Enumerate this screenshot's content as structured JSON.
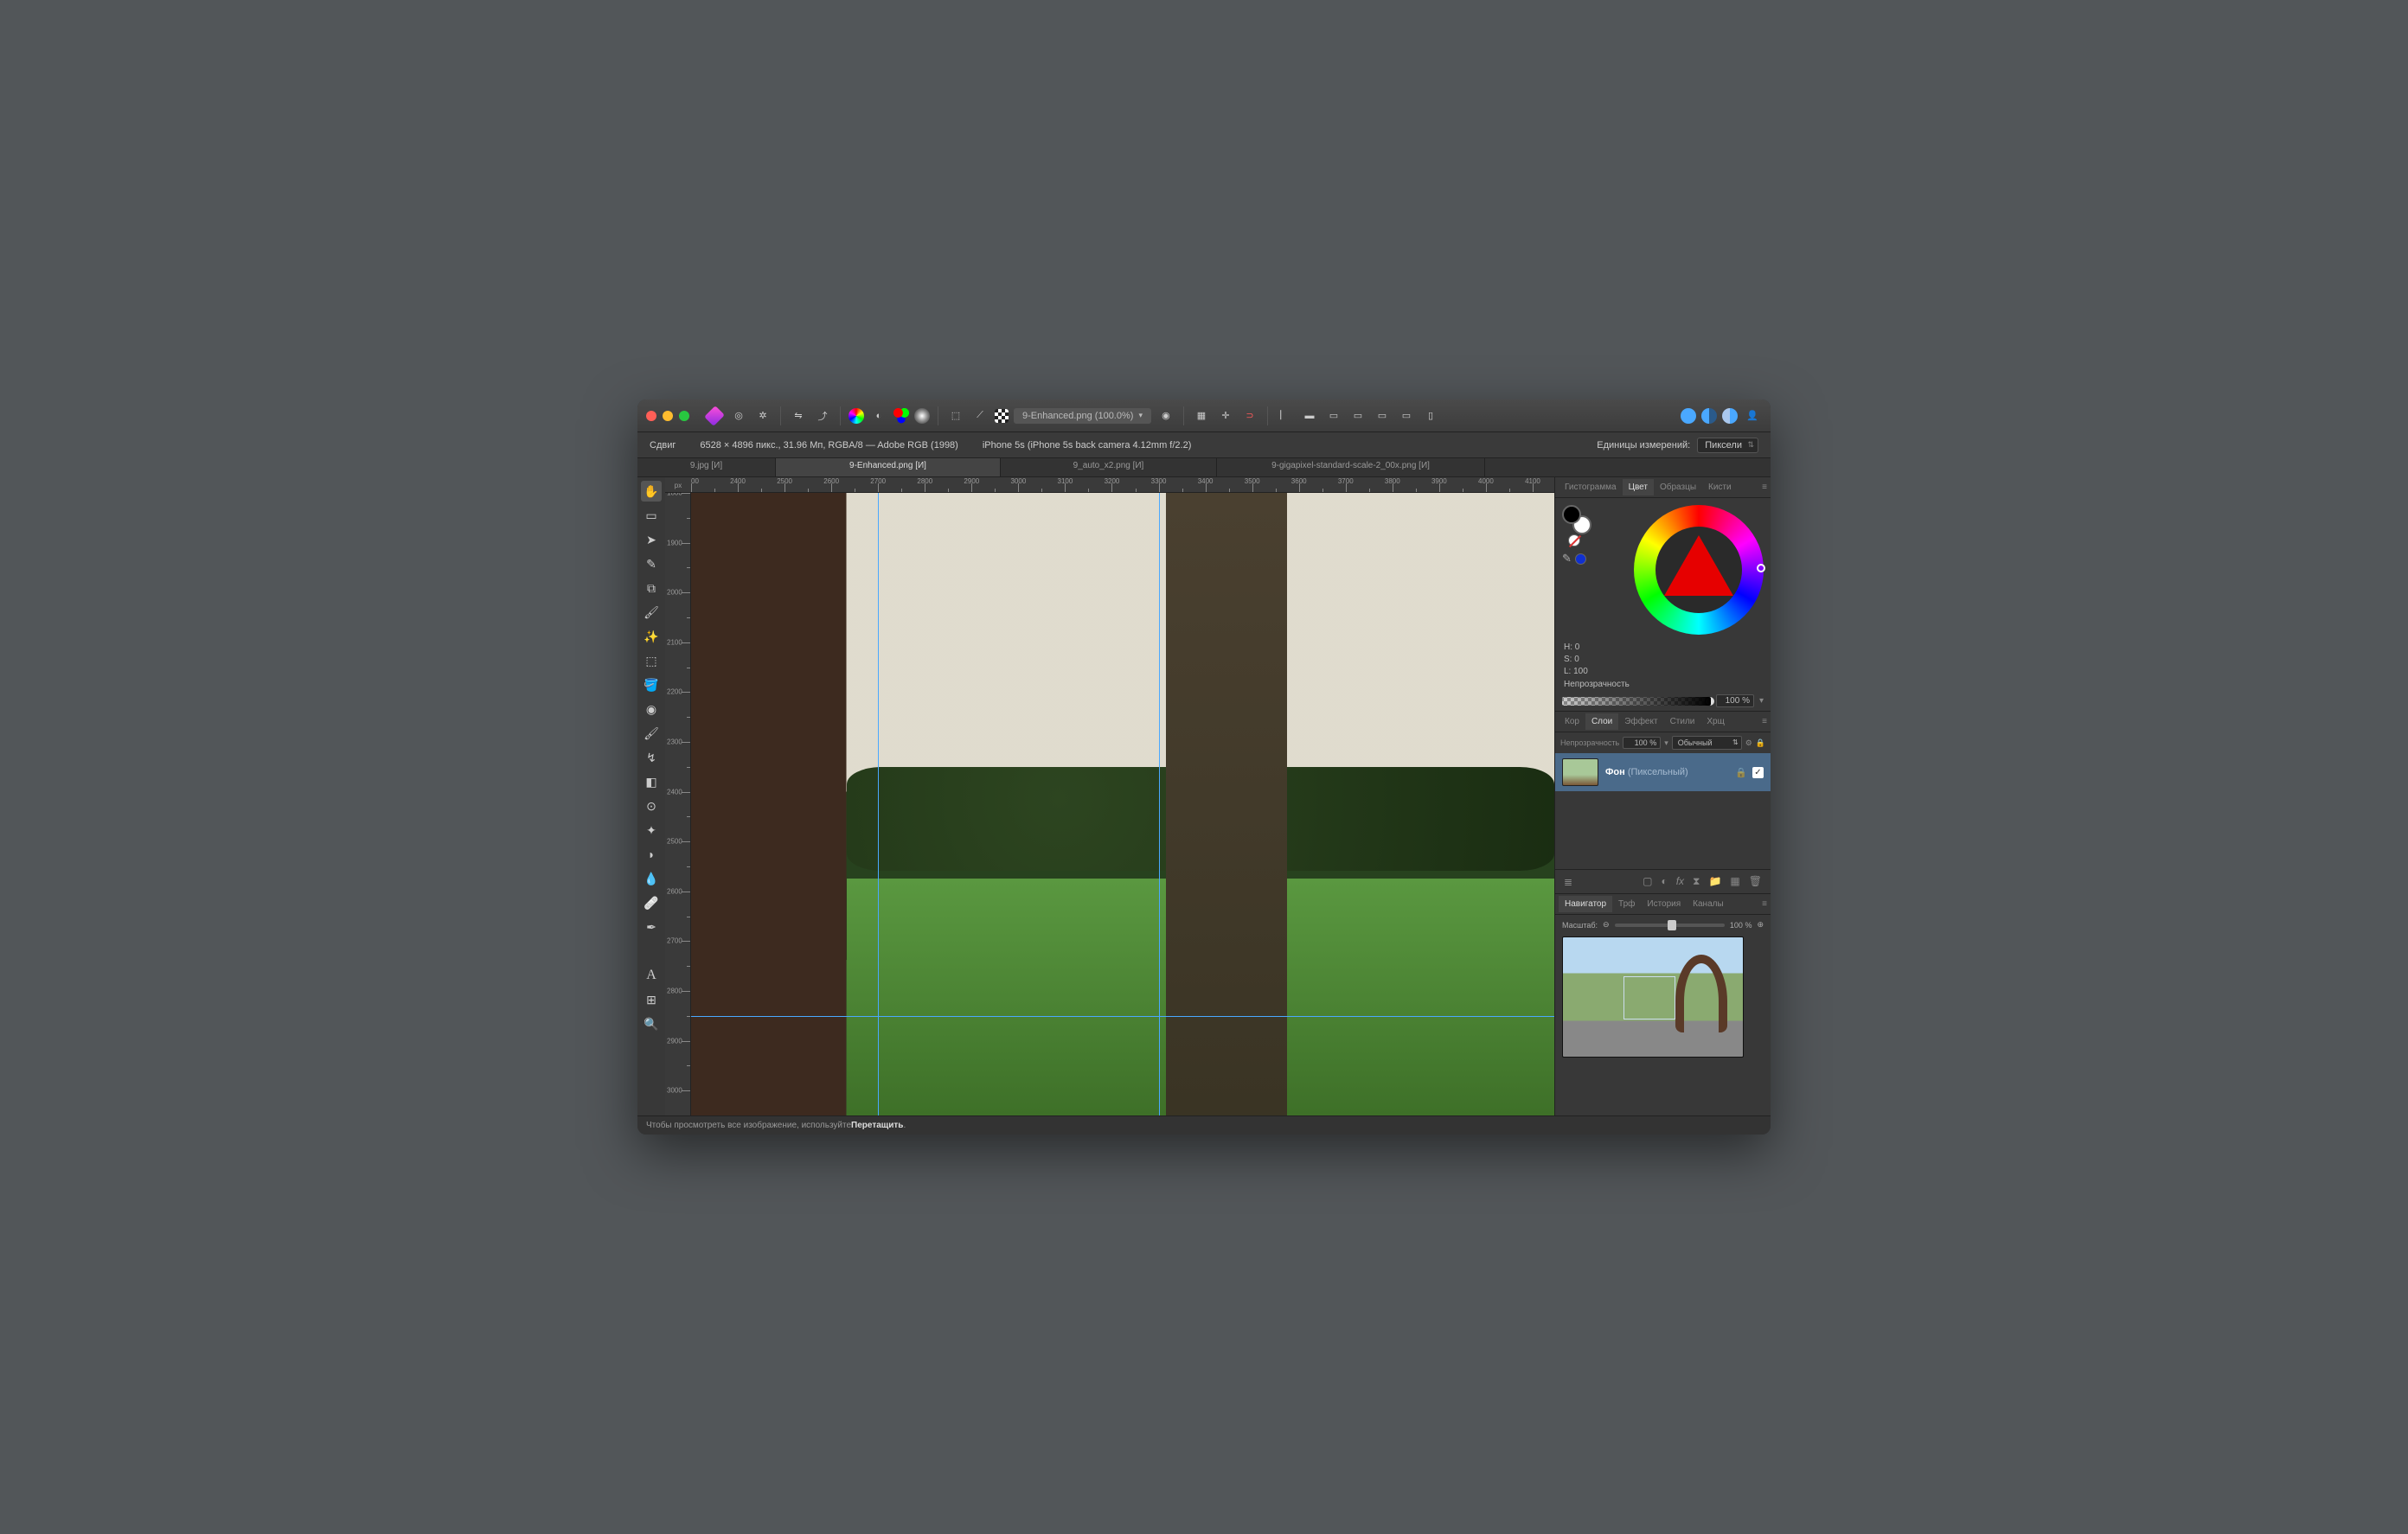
{
  "titlebar": {
    "doc_title": "9-Enhanced.png (100.0%)"
  },
  "infobar": {
    "tool": "Сдвиг",
    "dims": "6528 × 4896 пикс., 31.96 Мп, RGBA/8 — Adobe RGB (1998)",
    "camera": "iPhone 5s (iPhone 5s back camera 4.12mm f/2.2)",
    "units_label": "Единицы измерений:",
    "units_value": "Пиксели"
  },
  "doctabs": [
    "9.jpg [И]",
    "9-Enhanced.png [И]",
    "9_auto_x2.png [И]",
    "9-gigapixel-standard-scale-2_00x.png [И]"
  ],
  "ruler": {
    "unit": "px",
    "h_start": 2300,
    "h_end": 4150,
    "h_step": 50,
    "h_label_step": 100,
    "v_start": 1800,
    "v_end": 3050,
    "v_step": 50,
    "v_label_step": 100
  },
  "guides": {
    "v": [
      2700,
      3300
    ],
    "h": [
      2850
    ]
  },
  "panels": {
    "top_tabs": [
      "Гистограмма",
      "Цвет",
      "Образцы",
      "Кисти"
    ],
    "top_active": "Цвет",
    "hsl": {
      "h": "H: 0",
      "s": "S: 0",
      "l": "L: 100"
    },
    "opacity_label": "Непрозрачность",
    "opacity_value": "100 %",
    "mid_tabs": [
      "Кор",
      "Слои",
      "Эффект",
      "Стили",
      "Хрщ"
    ],
    "mid_active": "Слои",
    "layer_opacity_label": "Непрозрачность",
    "layer_opacity_value": "100 %",
    "blend_mode": "Обычный",
    "layer_name": "Фон",
    "layer_type": "(Пиксельный)",
    "bottom_tabs": [
      "Навигатор",
      "Трф",
      "История",
      "Каналы"
    ],
    "bottom_active": "Навигатор",
    "zoom_label": "Масштаб:",
    "zoom_value": "100 %"
  },
  "status": {
    "prefix": "Чтобы просмотреть все изображение, используйте ",
    "bold": "Перетащить",
    "suffix": "."
  }
}
